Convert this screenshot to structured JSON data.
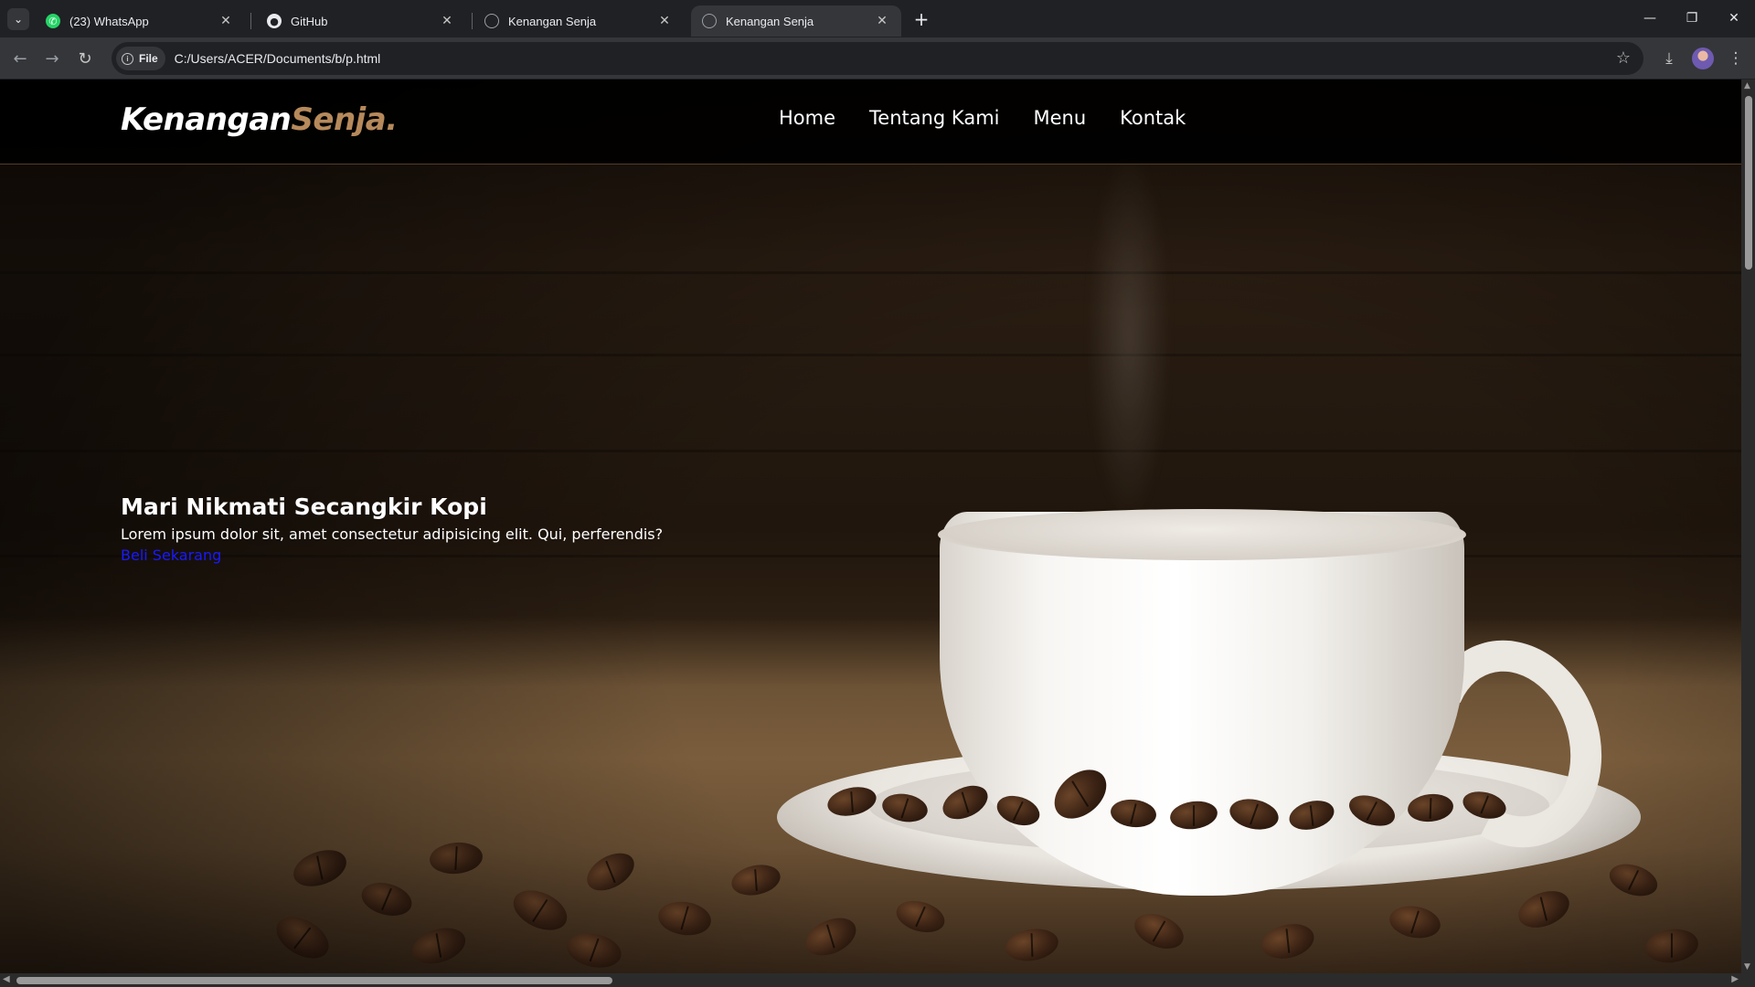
{
  "browser": {
    "tabs": [
      {
        "title": "(23) WhatsApp",
        "icon": "whatsapp-icon",
        "active": false
      },
      {
        "title": "GitHub",
        "icon": "github-icon",
        "active": false
      },
      {
        "title": "Kenangan Senja",
        "icon": "globe-icon",
        "active": false
      },
      {
        "title": "Kenangan Senja",
        "icon": "globe-icon",
        "active": true
      }
    ],
    "security_chip": "File",
    "url": "C:/Users/ACER/Documents/b/p.html"
  },
  "site": {
    "logo_main": "Kenangan",
    "logo_accent": "Senja",
    "logo_dot": ".",
    "nav": [
      "Home",
      "Tentang Kami",
      "Menu",
      "Kontak"
    ],
    "hero": {
      "title": "Mari Nikmati Secangkir Kopi",
      "description": "Lorem ipsum dolor sit, amet consectetur adipisicing elit. Qui, perferendis?",
      "cta": "Beli Sekarang"
    },
    "colors": {
      "accent": "#b6895b",
      "cta_link": "#1a1aff",
      "navbar_bg": "#000000"
    }
  }
}
